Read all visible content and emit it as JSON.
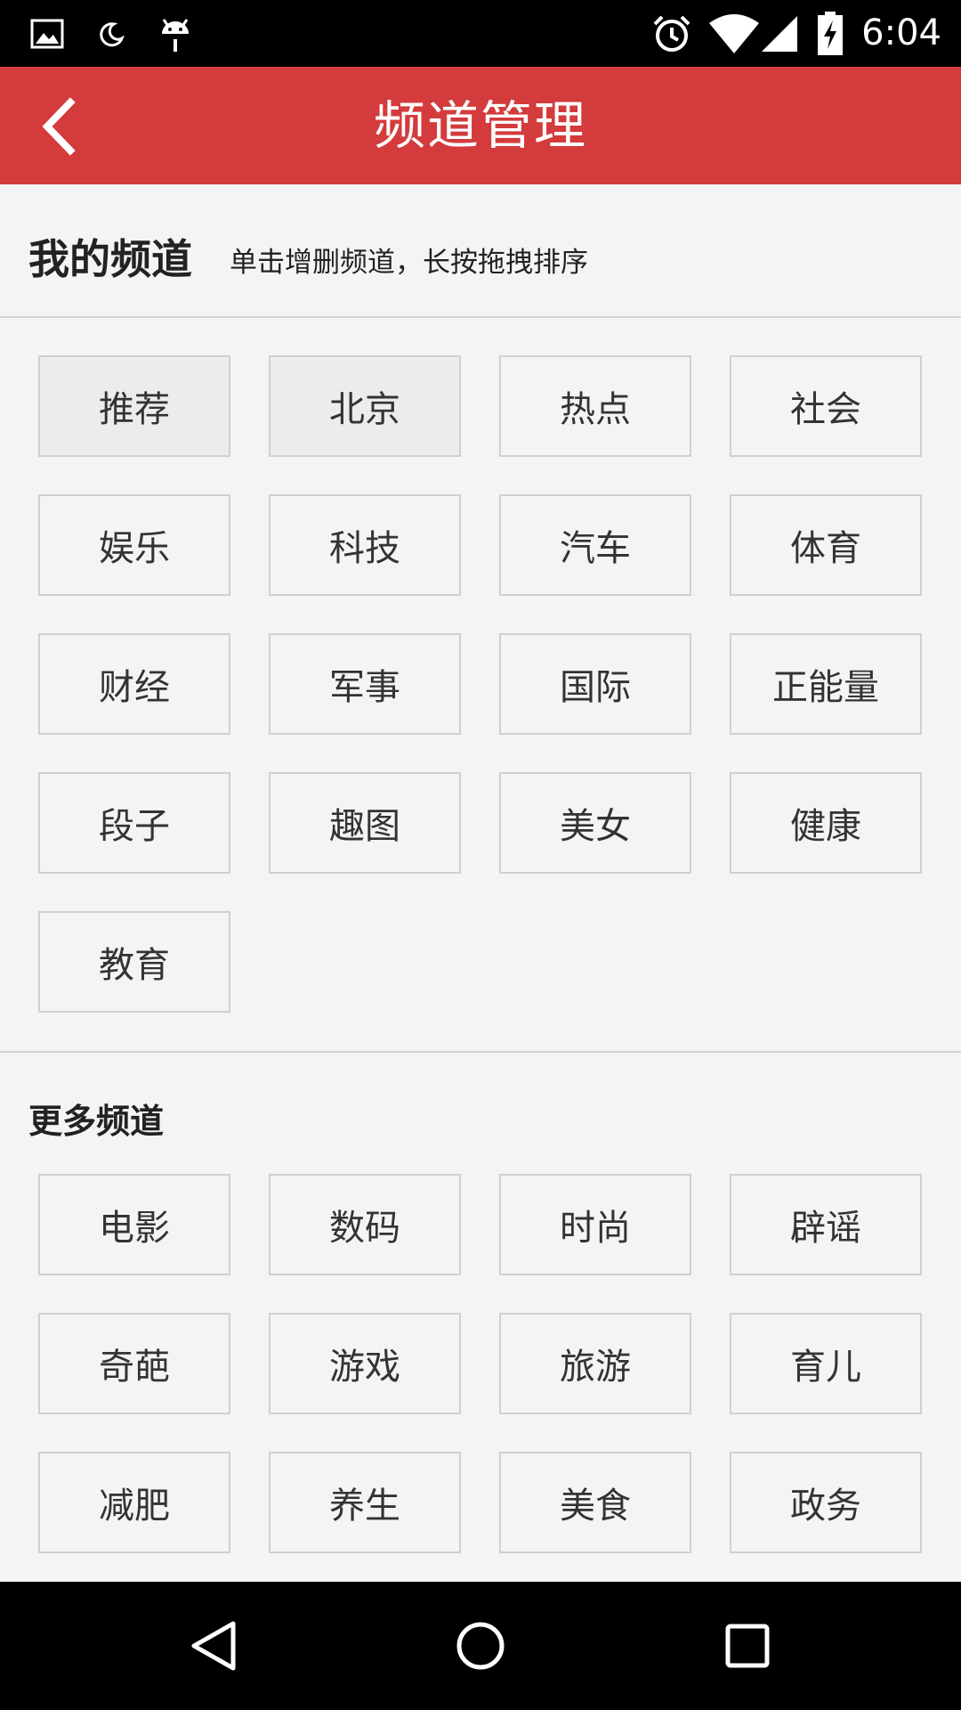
{
  "status_bar": {
    "time": "6:04",
    "left_icons": [
      "gallery-icon",
      "moon-icon",
      "android-icon"
    ],
    "right_icons": [
      "alarm-icon",
      "wifi-icon",
      "signal-icon",
      "battery-charging-icon"
    ]
  },
  "app_bar": {
    "title": "频道管理",
    "back_icon": "chevron-left-icon",
    "background": "#d33b3c"
  },
  "my_channels": {
    "title": "我的频道",
    "hint": "单击增删频道，长按拖拽排序",
    "items": [
      {
        "label": "推荐",
        "fixed": true
      },
      {
        "label": "北京",
        "fixed": true
      },
      {
        "label": "热点",
        "fixed": false
      },
      {
        "label": "社会",
        "fixed": false
      },
      {
        "label": "娱乐",
        "fixed": false
      },
      {
        "label": "科技",
        "fixed": false
      },
      {
        "label": "汽车",
        "fixed": false
      },
      {
        "label": "体育",
        "fixed": false
      },
      {
        "label": "财经",
        "fixed": false
      },
      {
        "label": "军事",
        "fixed": false
      },
      {
        "label": "国际",
        "fixed": false
      },
      {
        "label": "正能量",
        "fixed": false
      },
      {
        "label": "段子",
        "fixed": false
      },
      {
        "label": "趣图",
        "fixed": false
      },
      {
        "label": "美女",
        "fixed": false
      },
      {
        "label": "健康",
        "fixed": false
      },
      {
        "label": "教育",
        "fixed": false
      }
    ]
  },
  "more_channels": {
    "title": "更多频道",
    "items": [
      {
        "label": "电影"
      },
      {
        "label": "数码"
      },
      {
        "label": "时尚"
      },
      {
        "label": "辟谣"
      },
      {
        "label": "奇葩"
      },
      {
        "label": "游戏"
      },
      {
        "label": "旅游"
      },
      {
        "label": "育儿"
      },
      {
        "label": "减肥"
      },
      {
        "label": "养生"
      },
      {
        "label": "美食"
      },
      {
        "label": "政务"
      }
    ]
  },
  "nav_bar": {
    "buttons": [
      "back-triangle-icon",
      "home-circle-icon",
      "recents-square-icon"
    ]
  }
}
